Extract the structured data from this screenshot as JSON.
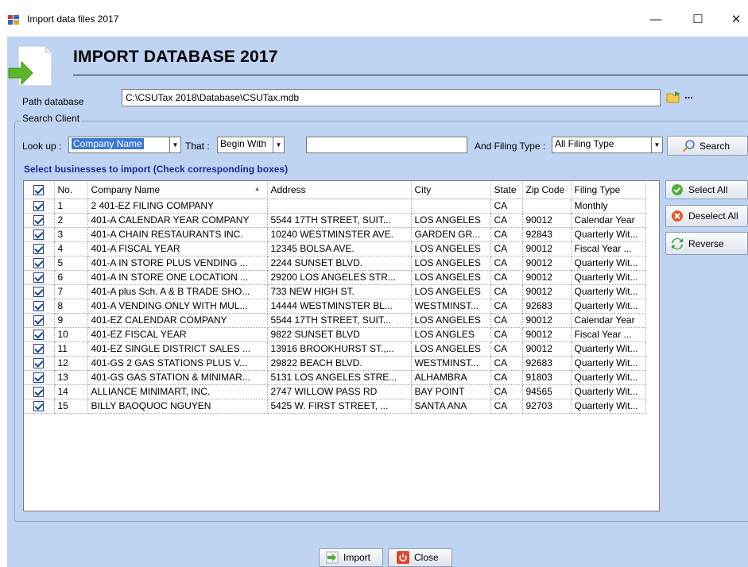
{
  "window": {
    "title": "Import data files 2017",
    "minimize": "—",
    "maximize": "☐",
    "close": "✕"
  },
  "header": {
    "title": "IMPORT DATABASE 2017"
  },
  "path": {
    "label": "Path database",
    "value": "C:\\CSUTax 2018\\Database\\CSUTax.mdb",
    "browse_label": "..."
  },
  "search": {
    "group_title": "Search Client",
    "lookup_label": "Look up :",
    "lookup_value": "Company Name",
    "that_label": "That :",
    "that_value": "Begin With",
    "text_value": "",
    "filing_label": "And Filing Type :",
    "filing_value": "All Filing Type",
    "search_button": "Search"
  },
  "grid_caption": "Select businesses to import (Check corresponding boxes)",
  "table": {
    "columns": [
      "",
      "No.",
      "Company Name",
      "Address",
      "City",
      "State",
      "Zip Code",
      "Filing Type"
    ],
    "rows": [
      {
        "no": "1",
        "company": "2 401-EZ FILING COMPANY",
        "address": "",
        "city": "",
        "state": "CA",
        "zip": "",
        "filing": "Monthly"
      },
      {
        "no": "2",
        "company": "401-A CALENDAR YEAR COMPANY",
        "address": "5544 17TH STREET, SUIT...",
        "city": "LOS ANGELES",
        "state": "CA",
        "zip": "90012",
        "filing": "Calendar Year"
      },
      {
        "no": "3",
        "company": "401-A CHAIN RESTAURANTS INC.",
        "address": "10240 WESTMINSTER AVE.",
        "city": "GARDEN GR...",
        "state": "CA",
        "zip": "92843",
        "filing": "Quarterly Wit..."
      },
      {
        "no": "4",
        "company": "401-A FISCAL YEAR",
        "address": "12345 BOLSA AVE.",
        "city": "LOS ANGELES",
        "state": "CA",
        "zip": "90012",
        "filing": "Fiscal Year ..."
      },
      {
        "no": "5",
        "company": "401-A IN STORE  PLUS VENDING ...",
        "address": "2244 SUNSET BLVD.",
        "city": "LOS ANGELES",
        "state": "CA",
        "zip": "90012",
        "filing": "Quarterly Wit..."
      },
      {
        "no": "6",
        "company": "401-A IN STORE ONE LOCATION ...",
        "address": "29200 LOS ANGELES STR...",
        "city": "LOS ANGELES",
        "state": "CA",
        "zip": "90012",
        "filing": "Quarterly Wit..."
      },
      {
        "no": "7",
        "company": "401-A plus Sch. A & B TRADE SHO...",
        "address": "733 NEW HIGH ST.",
        "city": "LOS ANGELES",
        "state": "CA",
        "zip": "90012",
        "filing": "Quarterly Wit..."
      },
      {
        "no": "8",
        "company": "401-A VENDING ONLY WITH MUL...",
        "address": "14444 WESTMINSTER BL...",
        "city": "WESTMINST...",
        "state": "CA",
        "zip": "92683",
        "filing": "Quarterly Wit..."
      },
      {
        "no": "9",
        "company": "401-EZ CALENDAR COMPANY",
        "address": "5544 17TH STREET, SUIT...",
        "city": "LOS ANGELES",
        "state": "CA",
        "zip": "90012",
        "filing": "Calendar Year"
      },
      {
        "no": "10",
        "company": "401-EZ FISCAL YEAR",
        "address": "9822 SUNSET BLVD",
        "city": "LOS ANGLES",
        "state": "CA",
        "zip": "90012",
        "filing": "Fiscal Year ..."
      },
      {
        "no": "11",
        "company": "401-EZ SINGLE DISTRICT SALES ...",
        "address": "13916 BROOKHURST ST.,...",
        "city": "LOS ANGELES",
        "state": "CA",
        "zip": "90012",
        "filing": "Quarterly Wit..."
      },
      {
        "no": "12",
        "company": "401-GS 2 GAS STATIONS PLUS V...",
        "address": "29822 BEACH BLVD.",
        "city": "WESTMINST...",
        "state": "CA",
        "zip": "92683",
        "filing": "Quarterly Wit..."
      },
      {
        "no": "13",
        "company": "401-GS GAS STATION & MINIMAR...",
        "address": "5131 LOS ANGELES STRE...",
        "city": "ALHAMBRA",
        "state": "CA",
        "zip": "91803",
        "filing": "Quarterly Wit..."
      },
      {
        "no": "14",
        "company": "ALLIANCE MINIMART, INC.",
        "address": "2747 WILLOW PASS RD",
        "city": "BAY POINT",
        "state": "CA",
        "zip": "94565",
        "filing": "Quarterly Wit..."
      },
      {
        "no": "15",
        "company": "BILLY BAOQUOC NGUYEN",
        "address": "5425 W. FIRST STREET, ...",
        "city": "SANTA ANA",
        "state": "CA",
        "zip": "92703",
        "filing": "Quarterly Wit..."
      }
    ]
  },
  "side_buttons": {
    "select_all": "Select All",
    "deselect_all": "Deselect All",
    "reverse": "Reverse"
  },
  "footer": {
    "import": "Import",
    "close": "Close"
  },
  "colors": {
    "client_bg": "#bfd3f2",
    "caption": "#1a2a9a",
    "selection": "#3a78d4"
  }
}
